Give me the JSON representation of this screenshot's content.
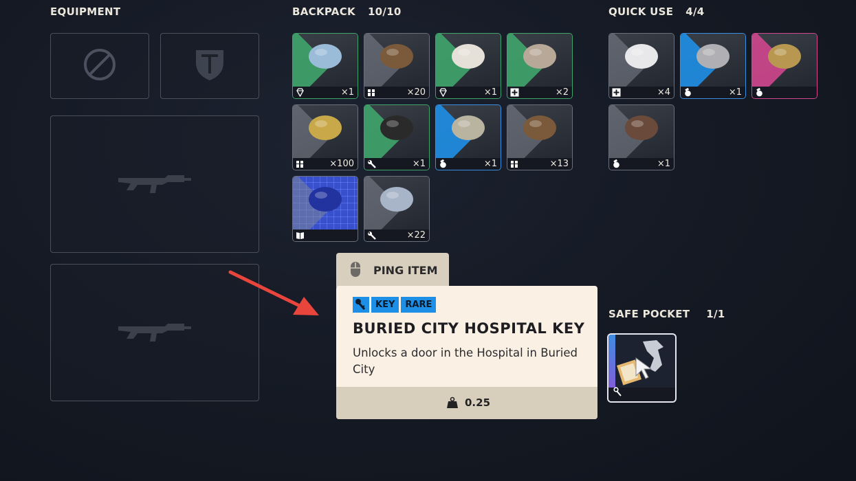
{
  "equipment": {
    "label": "EQUIPMENT",
    "slots": [
      {
        "icon": "prohibited-icon"
      },
      {
        "icon": "shield-emblem-icon"
      },
      {
        "icon": "rifle-silhouette-icon"
      },
      {
        "icon": "rifle-silhouette-icon"
      }
    ]
  },
  "backpack": {
    "label": "BACKPACK",
    "count": "10/10",
    "items": [
      {
        "name": "pillow-ring",
        "rarity": "green",
        "category_icon": "gem-icon",
        "qty": "×1"
      },
      {
        "name": "shotgun-shells-box",
        "rarity": "gray",
        "category_icon": "ammo-icon",
        "qty": "×20"
      },
      {
        "name": "pillow",
        "rarity": "green",
        "category_icon": "gem-icon",
        "qty": "×1"
      },
      {
        "name": "injector",
        "rarity": "green",
        "category_icon": "medical-icon",
        "qty": "×2"
      },
      {
        "name": "ammo-box",
        "rarity": "gray",
        "category_icon": "ammo-icon",
        "qty": "×100"
      },
      {
        "name": "duct-tape",
        "rarity": "green",
        "category_icon": "wrench-icon",
        "qty": "×1"
      },
      {
        "name": "flask-grenade",
        "rarity": "blue",
        "category_icon": "grenade-icon",
        "qty": "×1"
      },
      {
        "name": "shotgun-shells-box",
        "rarity": "gray",
        "category_icon": "ammo-icon",
        "qty": "×13"
      },
      {
        "name": "weapon-blueprint",
        "rarity": "gray",
        "category_icon": "book-icon",
        "qty": ""
      },
      {
        "name": "fabric-scraps",
        "rarity": "gray",
        "category_icon": "wrench-icon",
        "qty": "×22"
      }
    ]
  },
  "quick_use": {
    "label": "QUICK USE",
    "count": "4/4",
    "items": [
      {
        "name": "bandage",
        "rarity": "gray",
        "category_icon": "medical-icon",
        "qty": "×4"
      },
      {
        "name": "canister-grenade",
        "rarity": "blue",
        "category_icon": "grenade-icon",
        "qty": "×1"
      },
      {
        "name": "gold-canister",
        "rarity": "pink",
        "category_icon": "grenade-icon",
        "qty": ""
      },
      {
        "name": "frag-grenade",
        "rarity": "gray",
        "category_icon": "grenade-icon",
        "qty": "×1"
      }
    ]
  },
  "safe_pocket": {
    "label": "SAFE POCKET",
    "count": "1/1",
    "item": {
      "name": "hospital-key",
      "category_icon": "key-icon"
    }
  },
  "ping": {
    "label": "PING ITEM",
    "icon": "mouse-icon"
  },
  "tooltip": {
    "tags": [
      "KEY",
      "RARE"
    ],
    "title": "BURIED CITY HOSPITAL KEY",
    "description": "Unlocks a door in the Hospital in Buried City",
    "weight": "0.25",
    "weight_icon": "weight-icon"
  },
  "colors": {
    "green": "#3fa56a",
    "blue": "#1e8fe6",
    "pink": "#d0478e",
    "gray": "#6a707c",
    "tooltip_bg": "#faf0e3",
    "arrow": "#e8453c"
  }
}
